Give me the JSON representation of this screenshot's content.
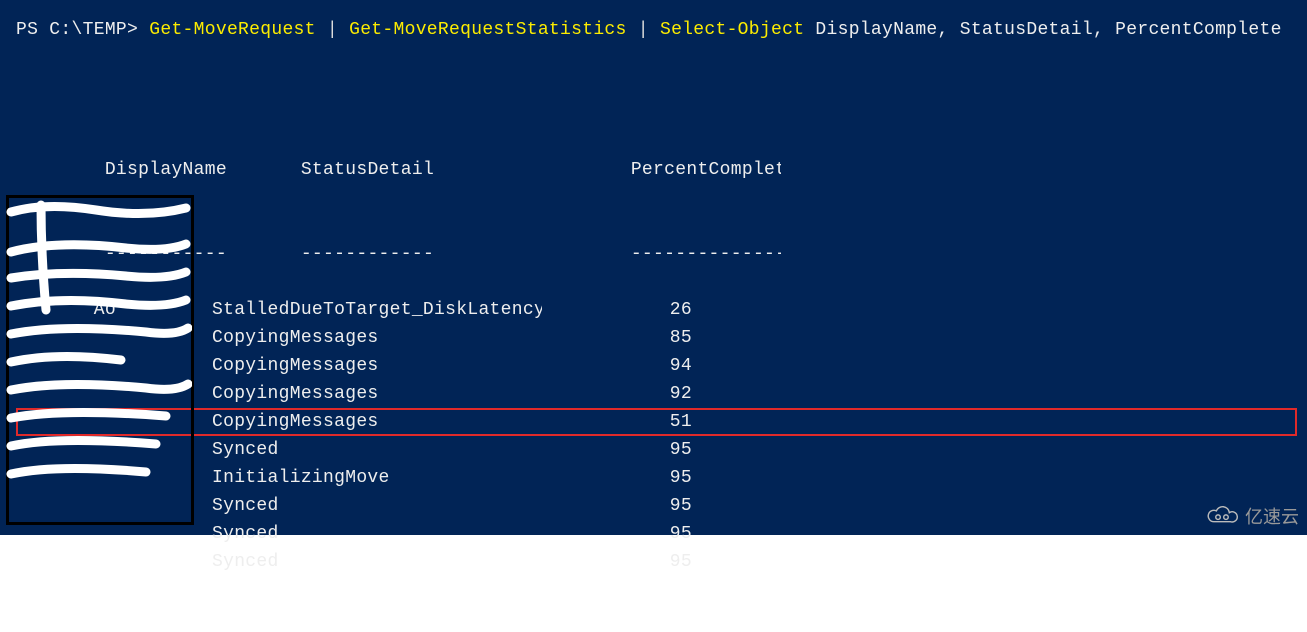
{
  "prompt": {
    "prefix": "PS C:\\TEMP>",
    "cmd1": "Get-MoveRequest",
    "pipe": "|",
    "cmd2": "Get-MoveRequestStatistics",
    "cmd3": "Select-Object",
    "args": "DisplayName, StatusDetail, PercentComplete"
  },
  "columns": {
    "name": "DisplayName",
    "status": "StatusDetail",
    "pct": "PercentComplete"
  },
  "dashes": {
    "name": "-----------",
    "status": "------------",
    "pct": "---------------"
  },
  "rows": [
    {
      "name": "       Ao",
      "status": "StalledDueToTarget_DiskLatency",
      "pct": "26",
      "hl": false
    },
    {
      "name": "",
      "status": "CopyingMessages",
      "pct": "85",
      "hl": false
    },
    {
      "name": "",
      "status": "CopyingMessages",
      "pct": "94",
      "hl": false
    },
    {
      "name": "",
      "status": "CopyingMessages",
      "pct": "92",
      "hl": false
    },
    {
      "name": "",
      "status": "CopyingMessages",
      "pct": "51",
      "hl": true
    },
    {
      "name": "",
      "status": "Synced",
      "pct": "95",
      "hl": false
    },
    {
      "name": "",
      "status": "InitializingMove",
      "pct": "95",
      "hl": false
    },
    {
      "name": "",
      "status": "Synced",
      "pct": "95",
      "hl": false
    },
    {
      "name": "",
      "status": "Synced",
      "pct": "95",
      "hl": false
    },
    {
      "name": "",
      "status": "Synced",
      "pct": "95",
      "hl": false
    }
  ],
  "watermark": {
    "text": "亿速云"
  }
}
